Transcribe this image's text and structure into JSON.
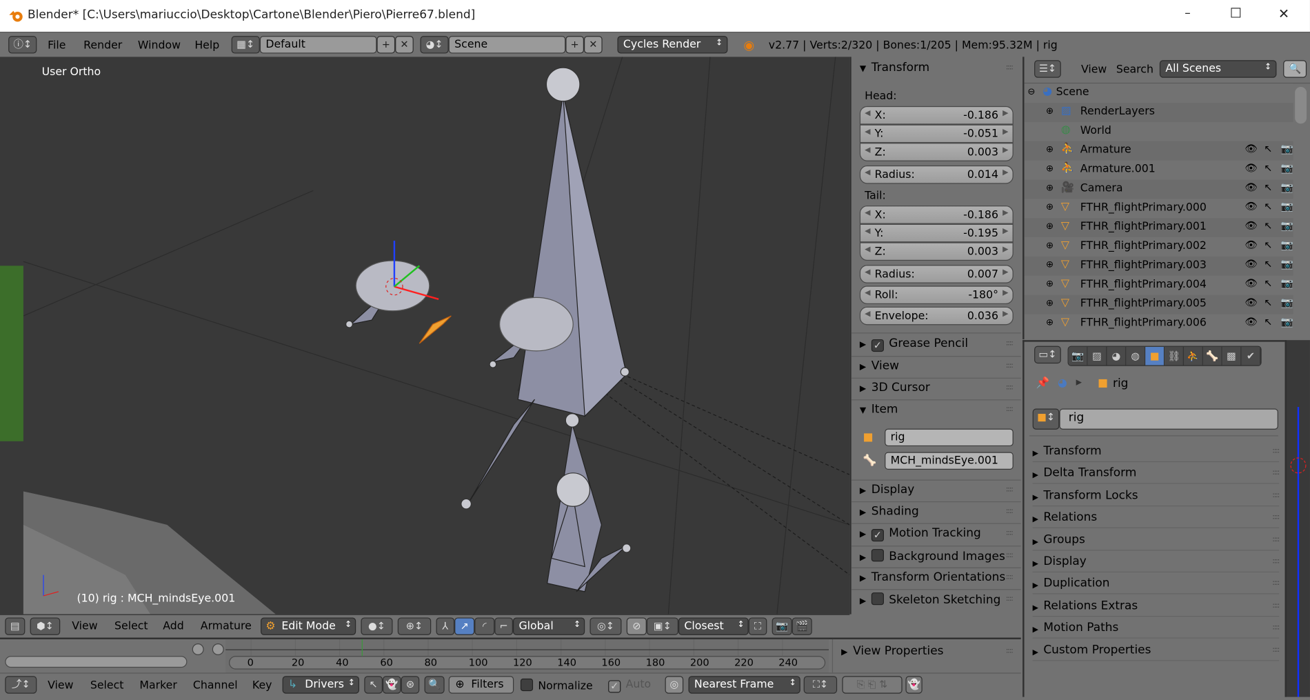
{
  "window": {
    "title": "Blender* [C:\\Users\\mariuccio\\Desktop\\Cartone\\Blender\\Piero\\Pierre67.blend]",
    "minimize": "–",
    "maximize": "☐",
    "close": "✕"
  },
  "topbar": {
    "menus": [
      "File",
      "Render",
      "Window",
      "Help"
    ],
    "layout": "Default",
    "scene": "Scene",
    "engine": "Cycles Render",
    "stats": "v2.77 | Verts:2/320 | Bones:1/205 | Mem:95.32M | rig"
  },
  "viewport": {
    "view_label": "User Ortho",
    "status": "(10) rig : MCH_mindsEye.001"
  },
  "npanel": {
    "transform_title": "Transform",
    "head_label": "Head:",
    "tail_label": "Tail:",
    "head": [
      {
        "label": "X:",
        "value": "-0.186"
      },
      {
        "label": "Y:",
        "value": "-0.051"
      },
      {
        "label": "Z:",
        "value": "0.003"
      }
    ],
    "head_radius": {
      "label": "Radius:",
      "value": "0.014"
    },
    "tail": [
      {
        "label": "X:",
        "value": "-0.186"
      },
      {
        "label": "Y:",
        "value": "-0.195"
      },
      {
        "label": "Z:",
        "value": "0.003"
      }
    ],
    "tail_radius": {
      "label": "Radius:",
      "value": "0.007"
    },
    "roll": {
      "label": "Roll:",
      "value": "-180°"
    },
    "envelope": {
      "label": "Envelope:",
      "value": "0.036"
    },
    "panels_a": [
      {
        "label": "Grease Pencil",
        "checkbox": true
      },
      {
        "label": "View"
      },
      {
        "label": "3D Cursor"
      }
    ],
    "item_title": "Item",
    "item_object": "rig",
    "item_bone": "MCH_mindsEye.001",
    "panels_b": [
      {
        "label": "Display"
      },
      {
        "label": "Shading"
      },
      {
        "label": "Motion Tracking",
        "checkbox": true,
        "checked": true
      },
      {
        "label": "Background Images",
        "checkbox": true
      },
      {
        "label": "Transform Orientations"
      },
      {
        "label": "Skeleton Sketching",
        "checkbox": true
      }
    ]
  },
  "outliner": {
    "menus": [
      "View",
      "Search"
    ],
    "filter": "All Scenes",
    "items": [
      {
        "name": "Scene",
        "depth": 0,
        "icon": "scene-icon"
      },
      {
        "name": "RenderLayers",
        "depth": 1,
        "icon": "renderlayers-icon"
      },
      {
        "name": "World",
        "depth": 1,
        "icon": "world-icon"
      },
      {
        "name": "Armature",
        "depth": 1,
        "icon": "armature-icon"
      },
      {
        "name": "Armature.001",
        "depth": 1,
        "icon": "armature-icon"
      },
      {
        "name": "Camera",
        "depth": 1,
        "icon": "camera-icon"
      },
      {
        "name": "FTHR_flightPrimary.000",
        "depth": 1,
        "icon": "mesh-icon"
      },
      {
        "name": "FTHR_flightPrimary.001",
        "depth": 1,
        "icon": "mesh-icon"
      },
      {
        "name": "FTHR_flightPrimary.002",
        "depth": 1,
        "icon": "mesh-icon"
      },
      {
        "name": "FTHR_flightPrimary.003",
        "depth": 1,
        "icon": "mesh-icon"
      },
      {
        "name": "FTHR_flightPrimary.004",
        "depth": 1,
        "icon": "mesh-icon"
      },
      {
        "name": "FTHR_flightPrimary.005",
        "depth": 1,
        "icon": "mesh-icon"
      },
      {
        "name": "FTHR_flightPrimary.006",
        "depth": 1,
        "icon": "mesh-icon"
      }
    ]
  },
  "properties": {
    "tabs": [
      "render",
      "render-layers",
      "scene",
      "world",
      "object",
      "constraints",
      "modifiers",
      "data",
      "material",
      "texture"
    ],
    "active_tab": "object",
    "breadcrumb": "rig",
    "object_name": "rig",
    "panels": [
      "Transform",
      "Delta Transform",
      "Transform Locks",
      "Relations",
      "Groups",
      "Display",
      "Duplication",
      "Relations Extras",
      "Motion Paths",
      "Custom Properties"
    ]
  },
  "view3d_header": {
    "menus": [
      "View",
      "Select",
      "Add",
      "Armature"
    ],
    "mode": "Edit Mode",
    "orientation": "Global",
    "snap": "Closest"
  },
  "timeline": {
    "ticks": [
      "0",
      "20",
      "40",
      "60",
      "80",
      "100",
      "120",
      "140",
      "160",
      "180",
      "200",
      "220",
      "240"
    ],
    "current_frame": 50,
    "view_properties": "View Properties"
  },
  "graph_header": {
    "menus": [
      "View",
      "Select",
      "Marker",
      "Channel",
      "Key"
    ],
    "mode": "Drivers",
    "filters": "Filters",
    "normalize": "Normalize",
    "auto": "Auto",
    "snap": "Nearest Frame"
  },
  "colors": {
    "accent": "#5680c2",
    "viewport_bg": "#393939",
    "panel_bg": "#727272",
    "bone": "#8d8fa4",
    "selected": "#f0a030"
  }
}
